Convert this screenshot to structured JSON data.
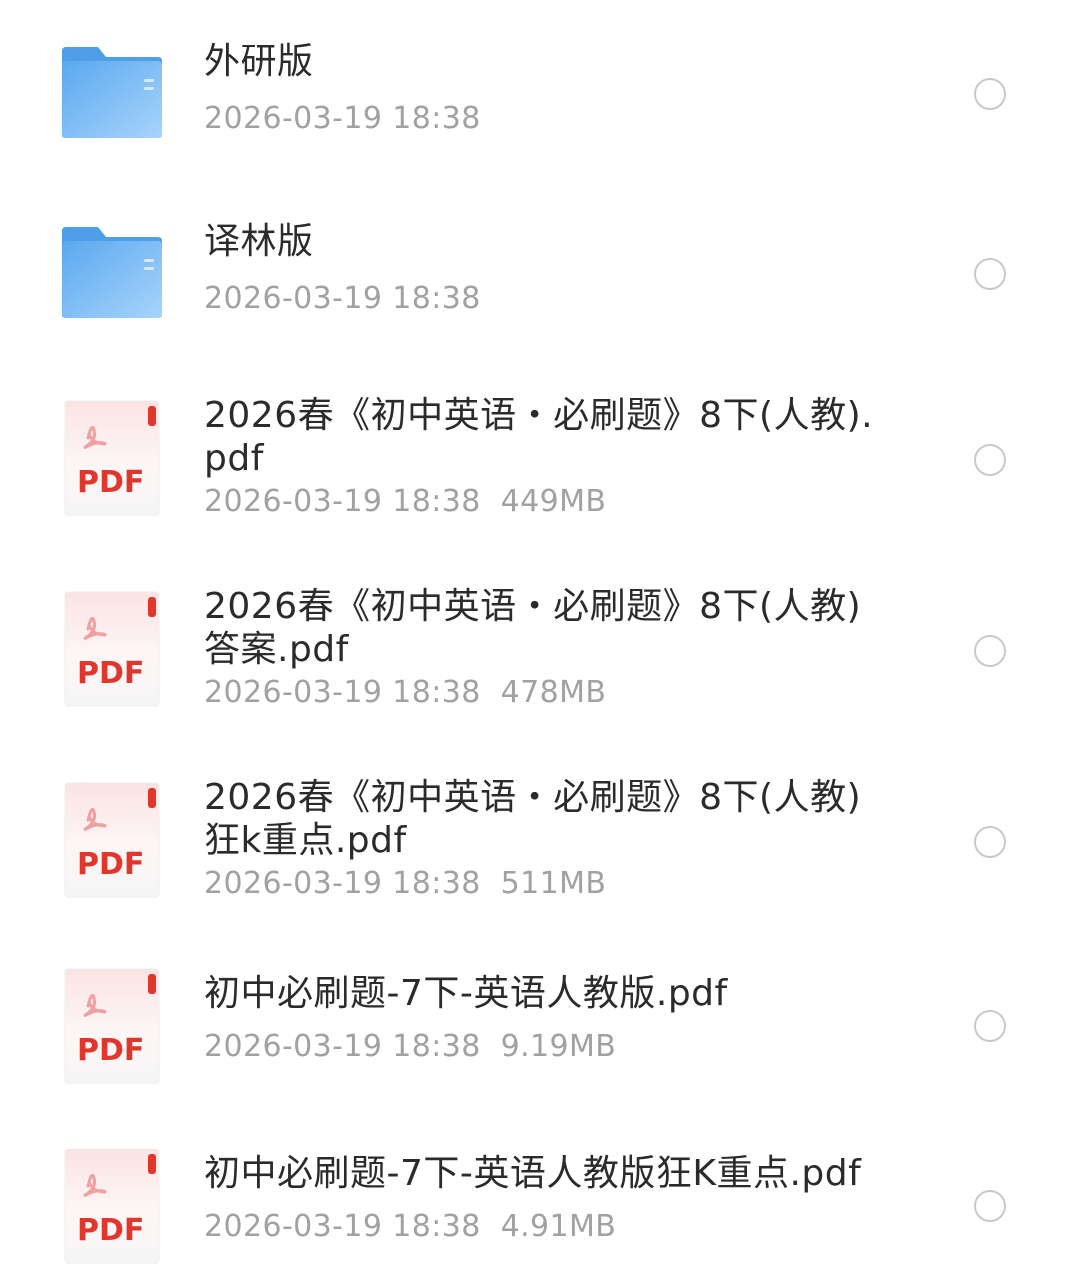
{
  "files": [
    {
      "type": "folder",
      "name": "外研版",
      "meta": "2026-03-19 18:38"
    },
    {
      "type": "folder",
      "name": "译林版",
      "meta": "2026-03-19 18:38"
    },
    {
      "type": "pdf",
      "name": "2026春《初中英语・必刷题》8下(人教).pdf",
      "meta": "2026-03-19 18:38  449MB",
      "badge": "PDF"
    },
    {
      "type": "pdf",
      "name": "2026春《初中英语・必刷题》8下(人教)答案.pdf",
      "meta": "2026-03-19 18:38  478MB",
      "badge": "PDF"
    },
    {
      "type": "pdf",
      "name": "2026春《初中英语・必刷题》8下(人教)狂k重点.pdf",
      "meta": "2026-03-19 18:38  511MB",
      "badge": "PDF"
    },
    {
      "type": "pdf",
      "name": "初中必刷题-7下-英语人教版.pdf",
      "meta": "2026-03-19 18:38  9.19MB",
      "badge": "PDF"
    },
    {
      "type": "pdf",
      "name": "初中必刷题-7下-英语人教版狂K重点.pdf",
      "meta": "2026-03-19 18:38  4.91MB",
      "badge": "PDF"
    }
  ],
  "colors": {
    "folder": "#6fb3f2",
    "pdf_red": "#e0362c",
    "text": "#2b2b2b",
    "meta": "#a1a1a1"
  }
}
